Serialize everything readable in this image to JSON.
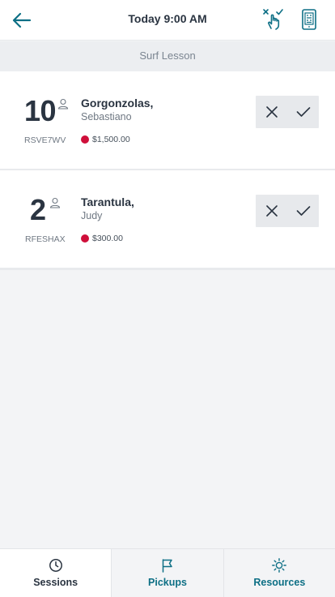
{
  "header": {
    "title": "Today 9:00 AM",
    "back_icon": "arrow-left-icon",
    "gesture_icon": "tap-select-icon",
    "scan_icon": "barcode-scanner-icon"
  },
  "section": {
    "title": "Surf Lesson"
  },
  "bookings": [
    {
      "quantity": "10",
      "last_name": "Gorgonzolas,",
      "first_name": "Sebastiano",
      "reference": "RSVE7WV",
      "amount": "$1,500.00",
      "status_color": "#cf0f3a"
    },
    {
      "quantity": "2",
      "last_name": "Tarantula,",
      "first_name": "Judy",
      "reference": "RFESHAX",
      "amount": "$300.00",
      "status_color": "#cf0f3a"
    }
  ],
  "tabs": [
    {
      "label": "Sessions",
      "icon": "clock-icon",
      "active": true
    },
    {
      "label": "Pickups",
      "icon": "flag-icon",
      "active": false
    },
    {
      "label": "Resources",
      "icon": "sun-icon",
      "active": false
    }
  ],
  "colors": {
    "accent": "#0d6f85",
    "text": "#2a3441",
    "status_dot": "#cf0f3a",
    "background": "#f3f4f6"
  }
}
